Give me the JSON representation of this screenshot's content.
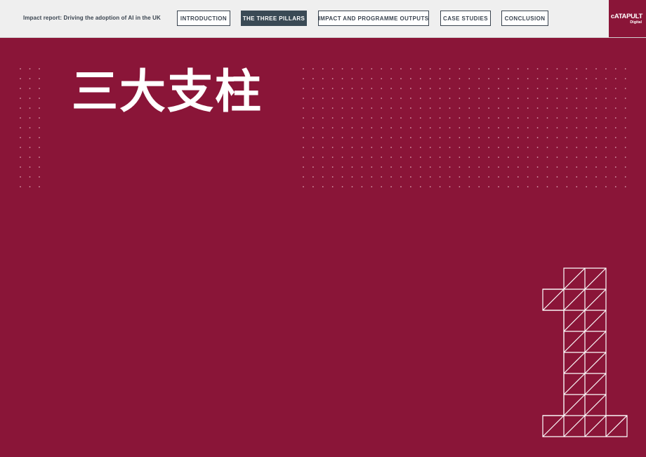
{
  "header": {
    "report_title": "Impact report: Driving the adoption of AI in the UK",
    "nav": [
      {
        "label": "INTRODUCTION",
        "active": false
      },
      {
        "label": "THE THREE PILLARS",
        "active": true
      },
      {
        "label": "IMPACT AND PROGRAMME OUTPUTS",
        "active": false
      },
      {
        "label": "CASE STUDIES",
        "active": false
      },
      {
        "label": "CONCLUSION",
        "active": false
      }
    ],
    "logo": {
      "main": "cATAPULT",
      "sub": "Digital"
    }
  },
  "main": {
    "heading": "三大支柱",
    "numeral_icon": "number-one-triangle-grid-icon"
  },
  "colors": {
    "background": "#8a1538",
    "active_nav": "#3a4a55",
    "nav_text": "#3a4450",
    "topbar": "#efefef"
  }
}
